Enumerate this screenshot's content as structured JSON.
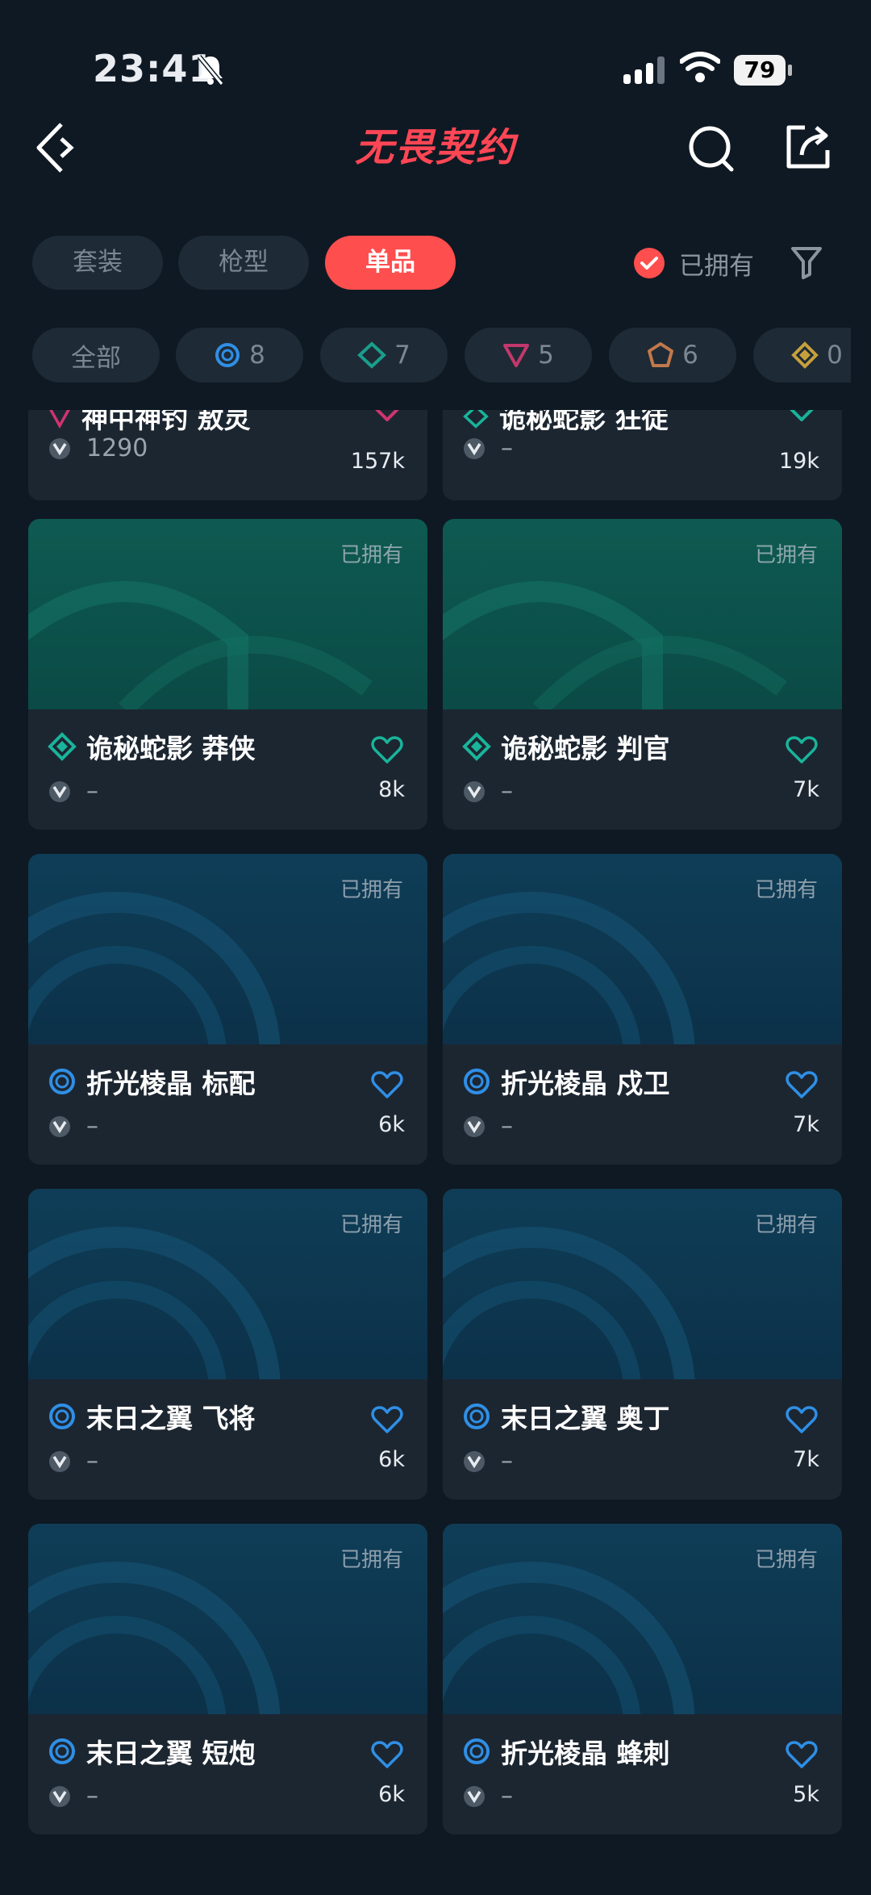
{
  "status_bar": {
    "time": "23:41",
    "battery": "79"
  },
  "header": {
    "title": "无畏契约"
  },
  "tabs": [
    {
      "label": "套装",
      "active": false
    },
    {
      "label": "枪型",
      "active": false
    },
    {
      "label": "单品",
      "active": true
    }
  ],
  "owned_filter": {
    "label": "已拥有",
    "checked": true
  },
  "chips": [
    {
      "label": "全部",
      "tier": "all"
    },
    {
      "label": "8",
      "tier": "select",
      "color": "#2f8fe6"
    },
    {
      "label": "7",
      "tier": "deluxe",
      "color": "#1a9e8c"
    },
    {
      "label": "5",
      "tier": "premium",
      "color": "#c2386c"
    },
    {
      "label": "6",
      "tier": "exclusive",
      "color": "#c2784a"
    },
    {
      "label": "0",
      "tier": "ultra",
      "color": "#c6a03c"
    }
  ],
  "partial_cards": [
    {
      "name": "神中神钓 敖灵",
      "price": "1290",
      "likes": "157k",
      "tier_color": "#d0346f"
    },
    {
      "name": "诡秘蛇影 狂徒",
      "price": "–",
      "likes": "19k",
      "tier_color": "#19b49b"
    }
  ],
  "cards": [
    {
      "name": "诡秘蛇影 莽侠",
      "owned": "已拥有",
      "price": "–",
      "likes": "8k",
      "tier_color": "#19b49b",
      "bg": "green",
      "weapon": "sniper"
    },
    {
      "name": "诡秘蛇影 判官",
      "owned": "已拥有",
      "price": "–",
      "likes": "7k",
      "tier_color": "#19b49b",
      "bg": "green",
      "weapon": "shotgun"
    },
    {
      "name": "折光棱晶 标配",
      "owned": "已拥有",
      "price": "–",
      "likes": "6k",
      "tier_color": "#2f8fe6",
      "bg": "blue",
      "weapon": "pistol"
    },
    {
      "name": "折光棱晶 戍卫",
      "owned": "已拥有",
      "price": "–",
      "likes": "7k",
      "tier_color": "#2f8fe6",
      "bg": "blue",
      "weapon": "rifle"
    },
    {
      "name": "末日之翼 飞将",
      "owned": "已拥有",
      "price": "–",
      "likes": "6k",
      "tier_color": "#2f8fe6",
      "bg": "blue",
      "weapon": "sniper"
    },
    {
      "name": "末日之翼 奥丁",
      "owned": "已拥有",
      "price": "–",
      "likes": "7k",
      "tier_color": "#2f8fe6",
      "bg": "blue",
      "weapon": "lmg"
    },
    {
      "name": "末日之翼 短炮",
      "owned": "已拥有",
      "price": "–",
      "likes": "6k",
      "tier_color": "#2f8fe6",
      "bg": "blue",
      "weapon": "shorty"
    },
    {
      "name": "折光棱晶 蜂刺",
      "owned": "已拥有",
      "price": "–",
      "likes": "5k",
      "tier_color": "#2f8fe6",
      "bg": "blue",
      "weapon": "smg"
    }
  ]
}
